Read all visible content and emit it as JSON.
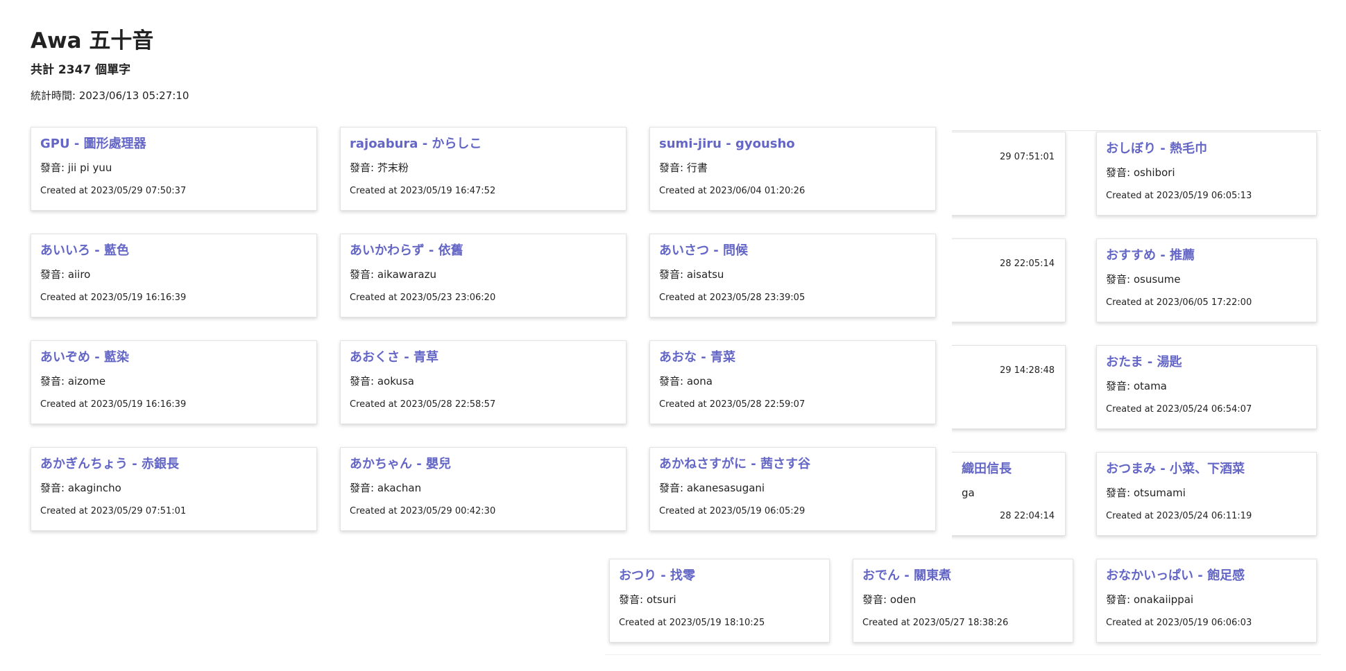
{
  "header": {
    "title": "Awa 五十音",
    "word_count": "共計 2347 個單字",
    "stat_time": "統計時間: 2023/06/13 05:27:10"
  },
  "grid_a": [
    {
      "title": "GPU - 圖形處理器",
      "reading": "發音: jii pi yuu",
      "created": "Created at 2023/05/29 07:50:37"
    },
    {
      "title": "rajoabura - からしこ",
      "reading": "發音: 芥末粉",
      "created": "Created at 2023/05/19 16:47:52"
    },
    {
      "title": "sumi-jiru - gyousho",
      "reading": "發音: 行書",
      "created": "Created at 2023/06/04 01:20:26"
    },
    {
      "title": "あいいろ - 藍色",
      "reading": "發音: aiiro",
      "created": "Created at 2023/05/19 16:16:39"
    },
    {
      "title": "あいかわらず - 依舊",
      "reading": "發音: aikawarazu",
      "created": "Created at 2023/05/23 23:06:20"
    },
    {
      "title": "あいさつ - 問候",
      "reading": "發音: aisatsu",
      "created": "Created at 2023/05/28 23:39:05"
    },
    {
      "title": "あいぞめ - 藍染",
      "reading": "發音: aizome",
      "created": "Created at 2023/05/19 16:16:39"
    },
    {
      "title": "あおくさ - 青草",
      "reading": "發音: aokusa",
      "created": "Created at 2023/05/28 22:58:57"
    },
    {
      "title": "あおな - 青菜",
      "reading": "發音: aona",
      "created": "Created at 2023/05/28 22:59:07"
    },
    {
      "title": "あかぎんちょう - 赤銀長",
      "reading": "發音: akagincho",
      "created": "Created at 2023/05/29 07:51:01"
    },
    {
      "title": "あかちゃん - 嬰兒",
      "reading": "發音: akachan",
      "created": "Created at 2023/05/29 00:42:30"
    },
    {
      "title": "あかねさすがに - 茜さす谷",
      "reading": "發音: akanesasugani",
      "created": "Created at 2023/05/19 06:05:29"
    }
  ],
  "grid_b_partial": [
    {
      "created_fragment": "29 07:51:01"
    },
    {
      "created_fragment": "28 22:05:14"
    },
    {
      "created_fragment": "29 14:28:48"
    },
    {
      "title_fragment": "織田信長",
      "reading_fragment": "ga",
      "created_fragment": "28 22:04:14"
    }
  ],
  "grid_b": [
    {
      "title": "おしぼり - 熱毛巾",
      "reading": "發音: oshibori",
      "created": "Created at 2023/05/19 06:05:13"
    },
    {
      "title": "おすすめ - 推薦",
      "reading": "發音: osusume",
      "created": "Created at 2023/06/05 17:22:00"
    },
    {
      "title": "おたま - 湯匙",
      "reading": "發音: otama",
      "created": "Created at 2023/05/24 06:54:07"
    },
    {
      "title": "おつまみ - 小菜、下酒菜",
      "reading": "發音: otsumami",
      "created": "Created at 2023/05/24 06:11:19"
    },
    {
      "title": "おつり - 找零",
      "reading": "發音: otsuri",
      "created": "Created at 2023/05/19 18:10:25"
    },
    {
      "title": "おでん - 關東煮",
      "reading": "發音: oden",
      "created": "Created at 2023/05/27 18:38:26"
    },
    {
      "title": "おなかいっぱい - 飽足感",
      "reading": "發音: onakaiippai",
      "created": "Created at 2023/05/19 06:06:03"
    }
  ]
}
